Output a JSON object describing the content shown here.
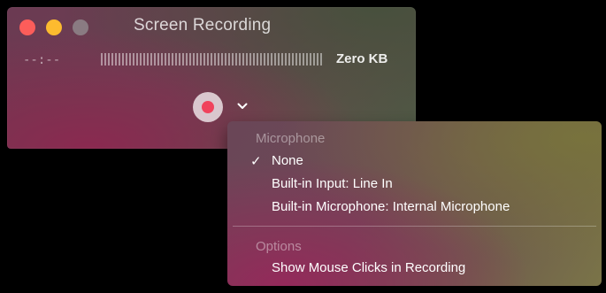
{
  "window": {
    "title": "Screen Recording",
    "timer": "--:--",
    "file_size": "Zero KB"
  },
  "menu": {
    "sections": [
      {
        "label": "Microphone",
        "items": [
          {
            "label": "None",
            "checked": true
          },
          {
            "label": "Built-in Input: Line In",
            "checked": false
          },
          {
            "label": "Built-in Microphone: Internal Microphone",
            "checked": false
          }
        ]
      },
      {
        "label": "Options",
        "items": [
          {
            "label": "Show Mouse Clicks in Recording",
            "checked": false
          }
        ]
      }
    ],
    "check_mark": "✓"
  },
  "colors": {
    "close": "#fc5d5a",
    "minimize": "#fdbb2f",
    "maximize": "#8a7b82",
    "record": "#f0435c"
  },
  "icons": {
    "record_button": "record-icon",
    "options": "chevron-down-icon"
  }
}
